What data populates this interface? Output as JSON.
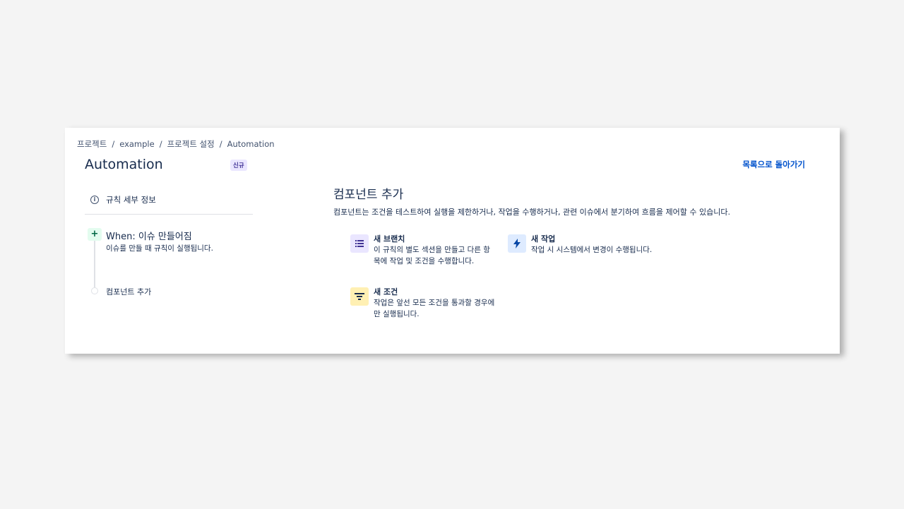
{
  "breadcrumb": [
    "프로젝트",
    "example",
    "프로젝트 설정",
    "Automation"
  ],
  "page_title": "Automation",
  "badge": "신규",
  "back_link": "목록으로 돌아가기",
  "sidebar": {
    "rule_details": "규칙 세부 정보",
    "trigger": {
      "title": "When: 이슈 만들어짐",
      "description": "이슈를 만들 때 규칙이 실행됩니다."
    },
    "add_component": "컴포넌트 추가"
  },
  "main": {
    "title": "컴포넌트 추가",
    "description": "컴포넌트는 조건을 테스트하여 실행을 제한하거나, 작업을 수행하거나, 관련 이슈에서 분기하여 흐름을 제어할 수 있습니다.",
    "options": [
      {
        "title": "새 브랜치",
        "description": "이 규칙의 별도 섹션을 만들고 다른 항목에 작업 및 조건을 수행합니다.",
        "icon": "branch-list-icon",
        "color": "#eae6ff"
      },
      {
        "title": "새 작업",
        "description": "작업 시 시스템에서 변경이 수행됩니다.",
        "icon": "lightning-icon",
        "color": "#deebff"
      },
      {
        "title": "새 조건",
        "description": "작업은 앞선 모든 조건을 통과할 경우에만 실행됩니다.",
        "icon": "filter-icon",
        "color": "#fff0b3"
      }
    ]
  },
  "colors": {
    "accent": "#0052cc",
    "text": "#172b4d"
  }
}
